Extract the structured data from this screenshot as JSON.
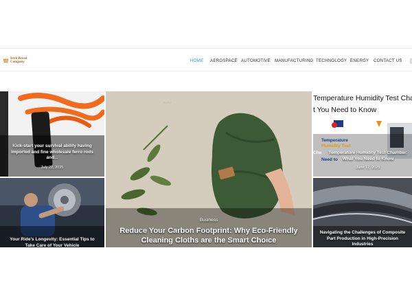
{
  "brand": {
    "logo_text": "Irish Bread Company"
  },
  "nav": {
    "items": [
      {
        "label": "HOME",
        "active": true
      },
      {
        "label": "AEROSPACE",
        "active": false
      },
      {
        "label": "AUTOMOTIVE",
        "active": false
      },
      {
        "label": "MANUFACTURING",
        "active": false
      },
      {
        "label": "TECHNOLOGY",
        "active": false
      },
      {
        "label": "ENERGY",
        "active": false
      },
      {
        "label": "CONTACT US",
        "active": false
      }
    ]
  },
  "colors": {
    "accent": "#1e9fd6",
    "logo": "#b5651d"
  },
  "posts": {
    "top_left": {
      "title": "Kick-start your survival ability having imported and fine wholesale ferro rods and...",
      "date": "July 22, 2025"
    },
    "bottom_left": {
      "title": "Your Ride's Longevity: Essential Tips to Take Care of Your Vehicle"
    },
    "featured": {
      "category": "Business",
      "title": "Reduce Your Carbon Footprint: Why Eco-Friendly Cleaning Cloths are the Smart Choice"
    },
    "top_right": {
      "banner_line1": "Temperature Humidity Test Cha",
      "banner_line2": "t You Need to Know",
      "box_label_1": "Temperature",
      "box_label_2": "Humidity Test",
      "box_label_3": "Cha",
      "box_label_4": "Need to",
      "title": "Temperature Humidity Test Chamber: What You Need to Know",
      "date": "June 12, 2025"
    },
    "bottom_right": {
      "title": "Navigating the Challenges of Composite Part Production in High-Precision Industries"
    }
  }
}
